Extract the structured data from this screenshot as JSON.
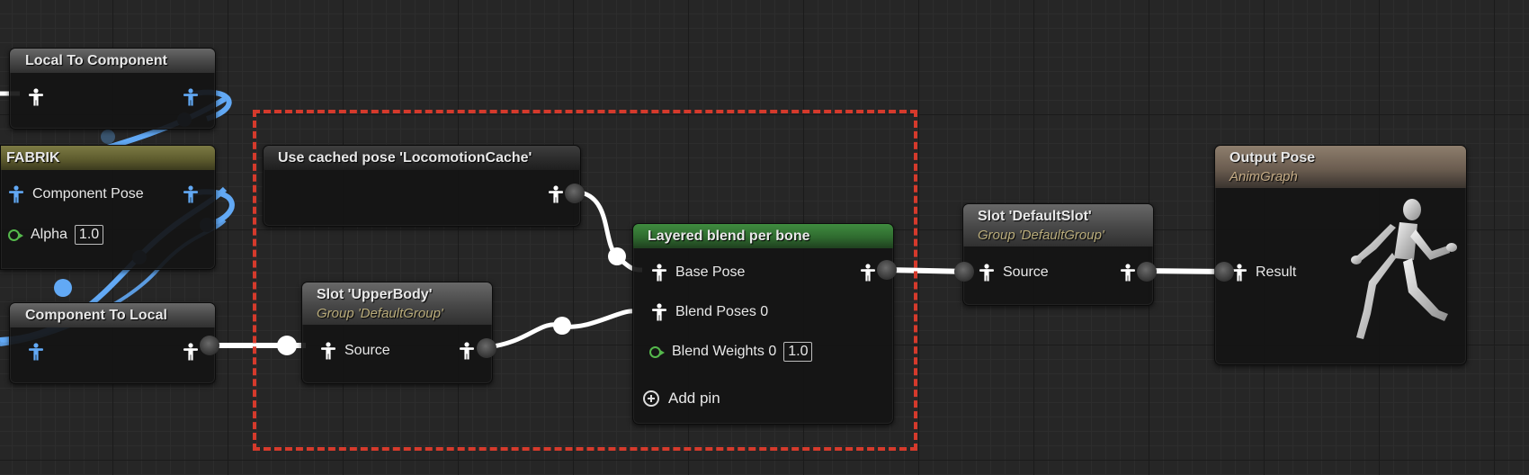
{
  "nodes": {
    "local_to_component": {
      "title": "Local To Component"
    },
    "fabrik": {
      "title": "FABRIK",
      "component_pose_label": "Component Pose",
      "alpha_label": "Alpha",
      "alpha_value": "1.0"
    },
    "component_to_local": {
      "title": "Component To Local"
    },
    "use_cached_pose": {
      "title": "Use cached pose 'LocomotionCache'"
    },
    "slot_upperbody": {
      "title": "Slot 'UpperBody'",
      "subtitle": "Group 'DefaultGroup'",
      "source_label": "Source"
    },
    "layered_blend": {
      "title": "Layered blend per bone",
      "base_pose_label": "Base Pose",
      "blend_poses_label": "Blend Poses 0",
      "blend_weights_label": "Blend Weights 0",
      "blend_weights_value": "1.0",
      "add_pin_label": "Add pin"
    },
    "slot_default": {
      "title": "Slot 'DefaultSlot'",
      "subtitle": "Group 'DefaultGroup'",
      "source_label": "Source"
    },
    "output_pose": {
      "title": "Output Pose",
      "subtitle": "AnimGraph",
      "result_label": "Result"
    }
  },
  "colors": {
    "pose_wire": "#ffffff",
    "component_space_wire": "#62a9f5",
    "selection_marquee": "#d53a2c",
    "float_pin": "#55b84c"
  },
  "icons": {
    "pose_pin": "person-pose-icon",
    "float_pin": "float-pin-icon",
    "add": "add-circle-icon",
    "preview": "mannequin-icon"
  }
}
